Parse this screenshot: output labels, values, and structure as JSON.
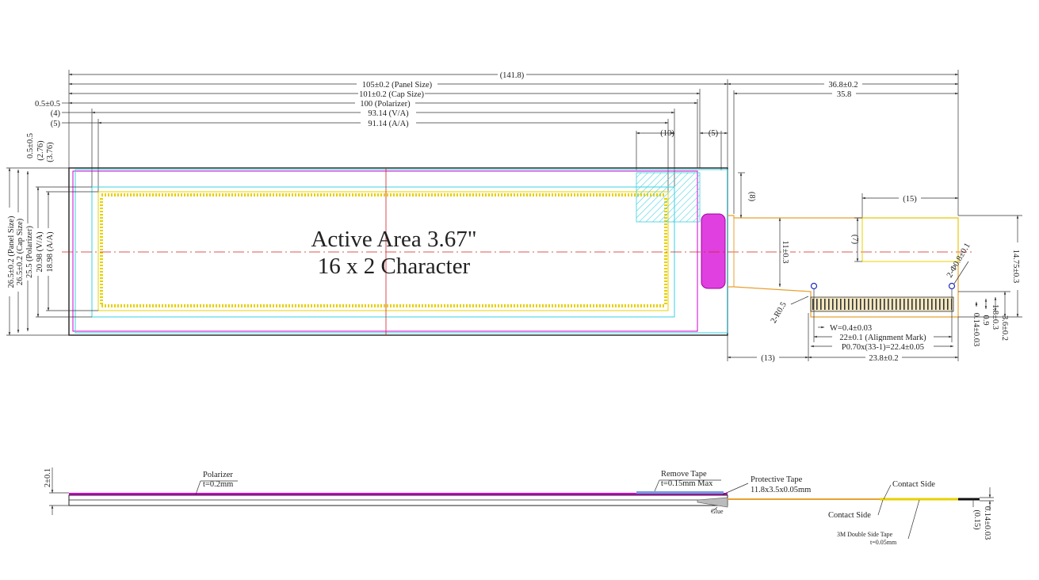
{
  "colors": {
    "outline": "#222222",
    "polarizer": "#d000d0",
    "cap": "#38d0e0",
    "active": "#e8d000",
    "flex": "#e8a030",
    "centerline": "#d02020",
    "alignment": "#2030c0"
  },
  "title": {
    "line1": "Active Area 3.67\"",
    "line2": "16 x 2 Character"
  },
  "dims_top": {
    "overall": "(141.8)",
    "panel": "105±0.2 (Panel Size)",
    "cap": "101±0.2 (Cap Size)",
    "polarizer": "100 (Polarizer)",
    "va": "93.14 (V/A)",
    "aa": "91.14 (A/A)",
    "tail": "36.8±0.2",
    "tail_inner": "35.8",
    "d10": "(10)",
    "d5r": "(5)",
    "d15": "(15)"
  },
  "dims_left_labels": {
    "a": "0.5±0.5",
    "b": "(4)",
    "c": "(5)"
  },
  "dims_left": {
    "a": "(3.76)",
    "b": "(2.76)",
    "c": "0.5±0.5",
    "aa": "18.98 (A/A)",
    "va": "20.98 (V/A)",
    "polarizer": "25.5 (Polarizer)",
    "cap": "26.5±0.2 (Cap Size)",
    "panel": "26.5±0.2 (Panel Size)"
  },
  "dims_right": {
    "d8": "(8)",
    "d11": "11±0.3",
    "d7": "(7)",
    "hole": "2-Φ0.8±0.1",
    "r05": "2-R0.5",
    "h1475": "14.75±0.3",
    "h36": "3.6±0.2",
    "h18": "1.8±0.3",
    "h09": "0.9",
    "h014": "0.14±0.03"
  },
  "dims_bottom": {
    "w": "W=0.4±0.03",
    "align": "22±0.1 (Alignment Mark)",
    "pitch": "P0.70x(33-1)=22.4±0.05",
    "d13": "(13)",
    "d238": "23.8±0.2"
  },
  "side": {
    "thickness": "2±0.1",
    "polarizer": "Polarizer",
    "polarizer_t": "t=0.2mm",
    "remove": "Remove Tape",
    "remove_t": "t=0.15mm Max",
    "protect": "Protective Tape",
    "protect_t": "11.8x3.5x0.05mm",
    "glue": "Glue",
    "contact1": "Contact Side",
    "contact2": "Contact Side",
    "tape3m": "3M Double Side Tape",
    "tape3m_t": "t=0.05mm",
    "t014": "0.14±0.03",
    "t015": "(0.15)"
  }
}
